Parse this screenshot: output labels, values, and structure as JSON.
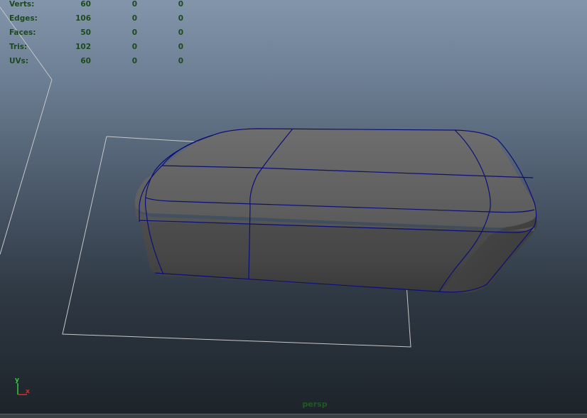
{
  "hud": {
    "rows": [
      {
        "label": "Verts:",
        "v1": "60",
        "v2": "0",
        "v3": "0"
      },
      {
        "label": "Edges:",
        "v1": "106",
        "v2": "0",
        "v3": "0"
      },
      {
        "label": "Faces:",
        "v1": "50",
        "v2": "0",
        "v3": "0"
      },
      {
        "label": "Tris:",
        "v1": "102",
        "v2": "0",
        "v3": "0"
      },
      {
        "label": "UVs:",
        "v1": "60",
        "v2": "0",
        "v3": "0"
      }
    ]
  },
  "axis": {
    "y_label": "y",
    "x_label": "x",
    "y_color": "#3cc83c",
    "x_color": "#d23030"
  },
  "camera": {
    "name": "persp"
  },
  "colors": {
    "wire": "#0b0f7a",
    "hud_text": "#1d4a1d",
    "grid": "#c8c8c8"
  }
}
